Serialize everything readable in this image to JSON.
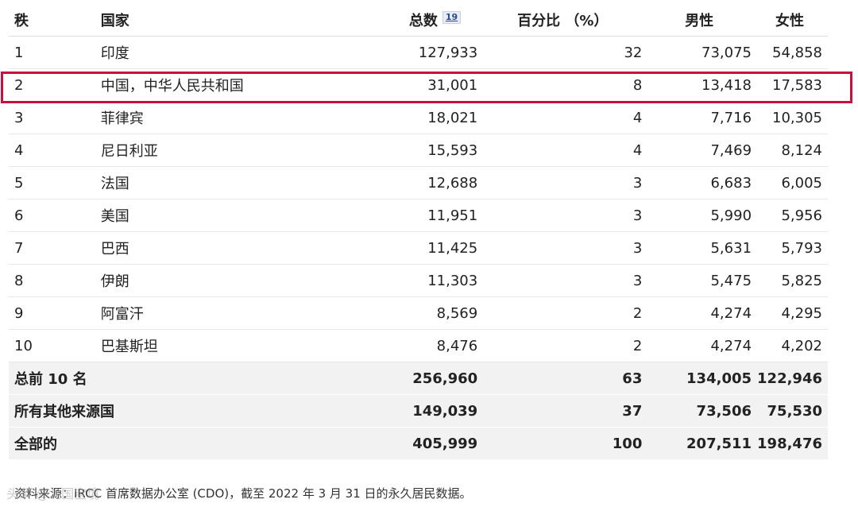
{
  "table": {
    "headers": {
      "rank": "秩",
      "country": "国家",
      "total": "总数",
      "total_footnote": "19",
      "percent": "百分比 （%）",
      "male": "男性",
      "female": "女性"
    },
    "rows": [
      {
        "rank": "1",
        "country": "印度",
        "total": "127,933",
        "percent": "32",
        "male": "73,075",
        "female": "54,858"
      },
      {
        "rank": "2",
        "country": "中国，中华人民共和国",
        "total": "31,001",
        "percent": "8",
        "male": "13,418",
        "female": "17,583"
      },
      {
        "rank": "3",
        "country": "菲律宾",
        "total": "18,021",
        "percent": "4",
        "male": "7,716",
        "female": "10,305"
      },
      {
        "rank": "4",
        "country": "尼日利亚",
        "total": "15,593",
        "percent": "4",
        "male": "7,469",
        "female": "8,124"
      },
      {
        "rank": "5",
        "country": "法国",
        "total": "12,688",
        "percent": "3",
        "male": "6,683",
        "female": "6,005"
      },
      {
        "rank": "6",
        "country": "美国",
        "total": "11,951",
        "percent": "3",
        "male": "5,990",
        "female": "5,956"
      },
      {
        "rank": "7",
        "country": "巴西",
        "total": "11,425",
        "percent": "3",
        "male": "5,631",
        "female": "5,793"
      },
      {
        "rank": "8",
        "country": "伊朗",
        "total": "11,303",
        "percent": "3",
        "male": "5,475",
        "female": "5,825"
      },
      {
        "rank": "9",
        "country": "阿富汗",
        "total": "8,569",
        "percent": "2",
        "male": "4,274",
        "female": "4,295"
      },
      {
        "rank": "10",
        "country": "巴基斯坦",
        "total": "8,476",
        "percent": "2",
        "male": "4,274",
        "female": "4,202"
      }
    ],
    "summary": [
      {
        "label": "总前 10 名",
        "total": "256,960",
        "percent": "63",
        "male": "134,005",
        "female": "122,946"
      },
      {
        "label": "所有其他来源国",
        "total": "149,039",
        "percent": "37",
        "male": "73,506",
        "female": "75,530"
      },
      {
        "label": "全部的",
        "total": "405,999",
        "percent": "100",
        "male": "207,511",
        "female": "198,476"
      }
    ]
  },
  "source": "资料来源：IRCC 首席数据办公室 (CDO)，截至 2022 年 3 月 31 日的永久居民数据。",
  "watermark": "头条 @北国宝境",
  "colors": {
    "highlight": "#c8103e",
    "summary_bg": "#f2f2f2",
    "footnote": "#2b4b8a"
  }
}
